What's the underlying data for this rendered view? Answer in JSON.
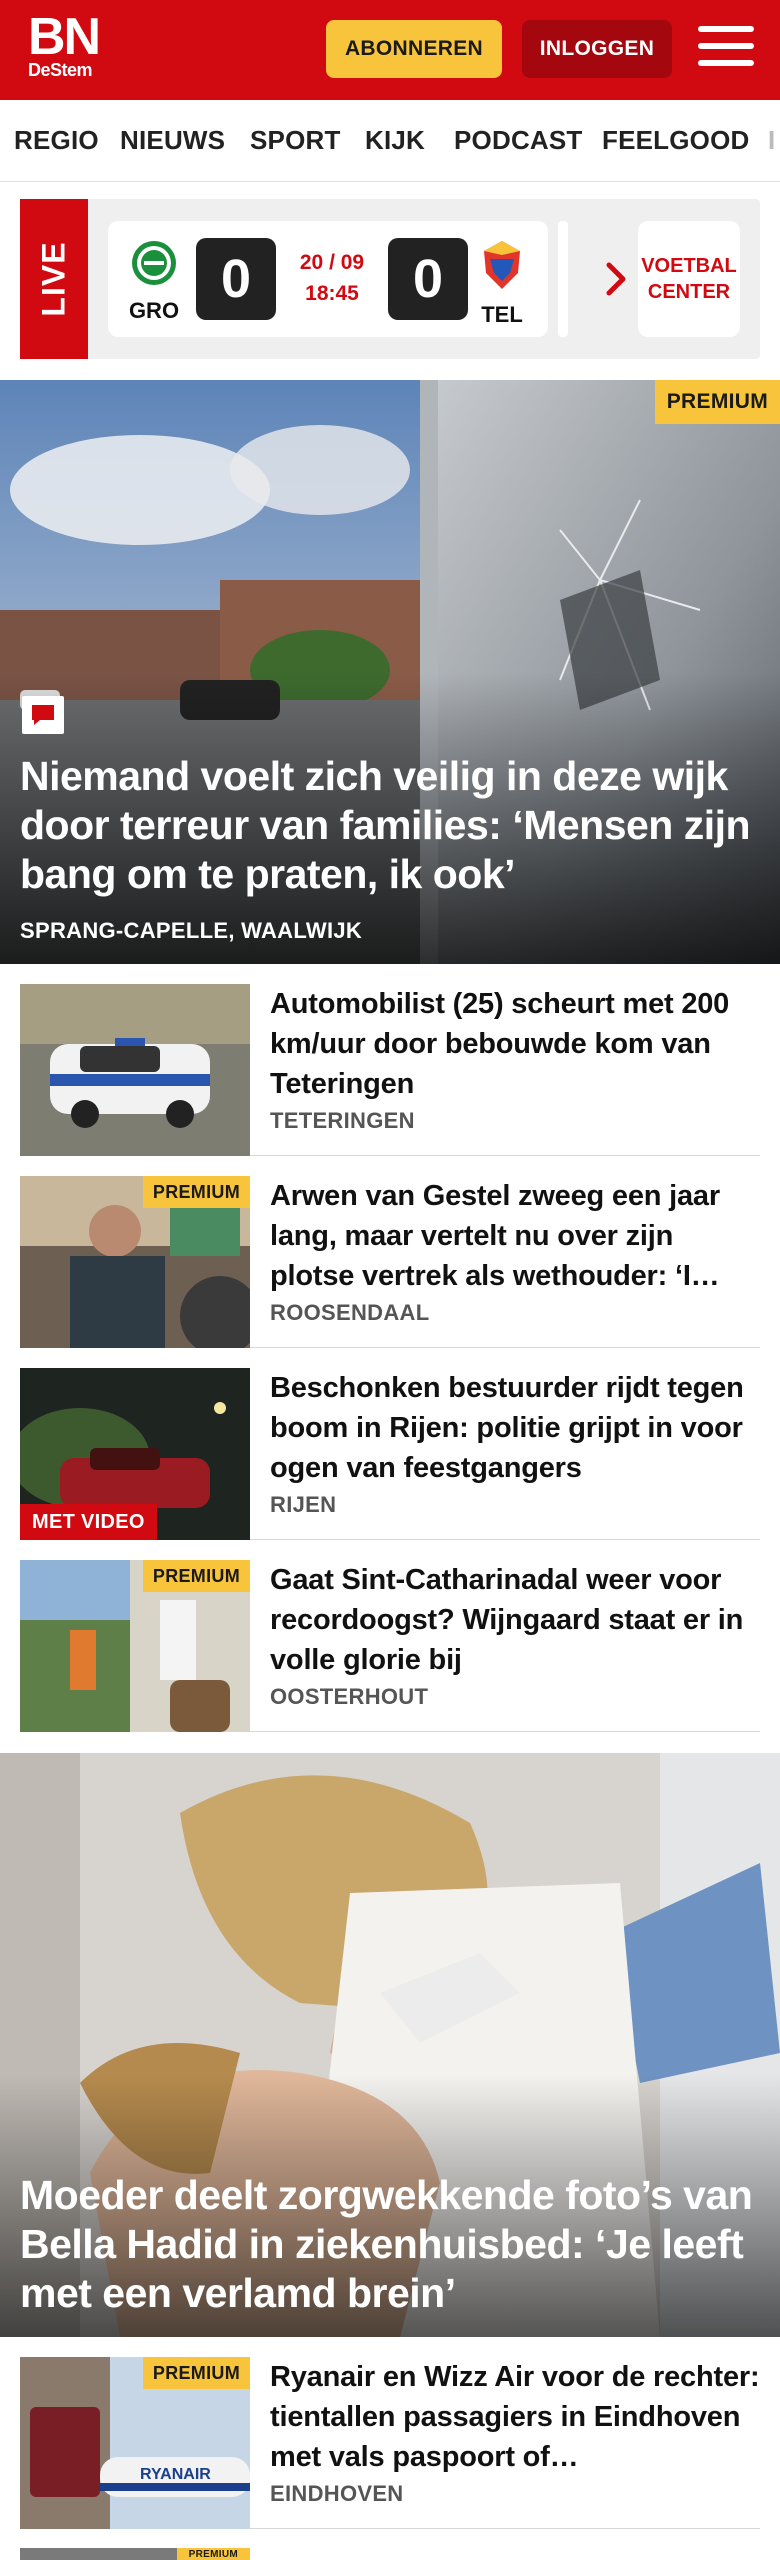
{
  "header": {
    "logo_main": "BN",
    "logo_sub": "DeStem",
    "subscribe_label": "ABONNEREN",
    "login_label": "INLOGGEN",
    "brand_color": "#d10a11"
  },
  "nav": {
    "items": [
      "REGIO",
      "NIEUWS",
      "SPORT",
      "KIJK",
      "PODCAST",
      "FEELGOOD",
      "I"
    ]
  },
  "live": {
    "label": "LIVE",
    "home_team": "GRO",
    "away_team": "TEL",
    "home_score": "0",
    "away_score": "0",
    "date": "20 / 09",
    "time": "18:45",
    "voetbal_center": "VOETBAL CENTER"
  },
  "hero": {
    "badge": "PREMIUM",
    "comment_icon": "comment-icon",
    "title": "Niemand voelt zich veilig in deze wijk door terreur van families: ‘Mensen zijn bang om te praten, ik ook’",
    "location": "SPRANG-CAPELLE, WAALWIJK"
  },
  "articles": [
    {
      "title": "Automobilist (25) scheurt met 200 km/uur door bebouwde kom van Teteringen",
      "location": "TETERINGEN",
      "badge": ""
    },
    {
      "title": "Arwen van Gestel zweeg een jaar lang, maar vertelt nu over zijn plotse vertrek als wethouder: ‘I…",
      "location": "ROOSENDAAL",
      "badge": "PREMIUM"
    },
    {
      "title": "Beschonken bestuurder rijdt tegen boom in Rijen: politie grijpt in voor ogen van feestgangers",
      "location": "RIJEN",
      "badge": "MET VIDEO"
    },
    {
      "title": "Gaat Sint-Catharinadal weer voor recordoogst? Wijngaard staat er in volle glorie bij",
      "location": "OOSTERHOUT",
      "badge": "PREMIUM"
    }
  ],
  "hero2": {
    "title": "Moeder deelt zorgwekkende foto’s van Bella Hadid in ziekenhuisbed: ‘Je leeft met een verlamd brein’"
  },
  "articles2": [
    {
      "title": "Ryanair en Wizz Air voor de rechter: tientallen passagiers in Eindhoven met vals paspoort of…",
      "location": "EINDHOVEN",
      "badge": "PREMIUM",
      "image_text": "RYANAIR"
    }
  ],
  "partial_badge": "PREMIUM"
}
